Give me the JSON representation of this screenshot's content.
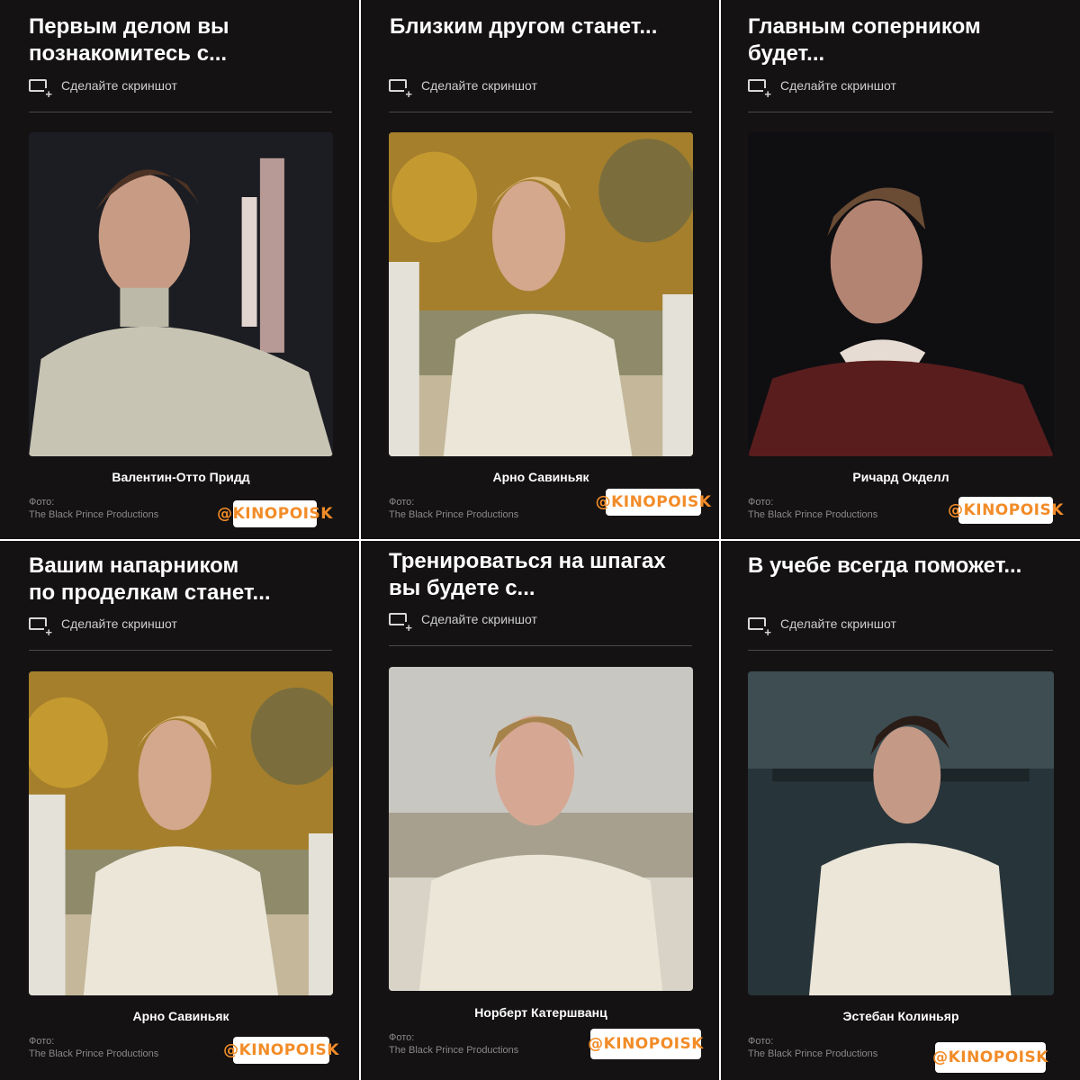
{
  "screenshot_label": "Сделайте скриншот",
  "credit_label": "Фото:",
  "credit_source": "The Black Prince Productions",
  "badge_text": "@KINOPOISK",
  "colors": {
    "card_bg": "#141213",
    "badge_text": "#f28c28",
    "title": "#ffffff"
  },
  "cards": [
    {
      "title_line1": "Первым делом вы",
      "title_line2": "познакомитесь с...",
      "name": "Валентин-Отто Придд"
    },
    {
      "title_line1": "Близким другом станет...",
      "title_line2": "",
      "name": "Арно Савиньяк"
    },
    {
      "title_line1": "Главным соперником",
      "title_line2": "будет...",
      "name": "Ричард Окделл"
    },
    {
      "title_line1": "Вашим напарником",
      "title_line2": "по проделкам станет...",
      "name": "Арно Савиньяк"
    },
    {
      "title_line1": "Тренироваться на шпагах",
      "title_line2": "вы будете с...",
      "name": "Норберт Катершванц"
    },
    {
      "title_line1": "В учебе всегда поможет...",
      "title_line2": "",
      "name": "Эстебан Колиньяр"
    }
  ]
}
